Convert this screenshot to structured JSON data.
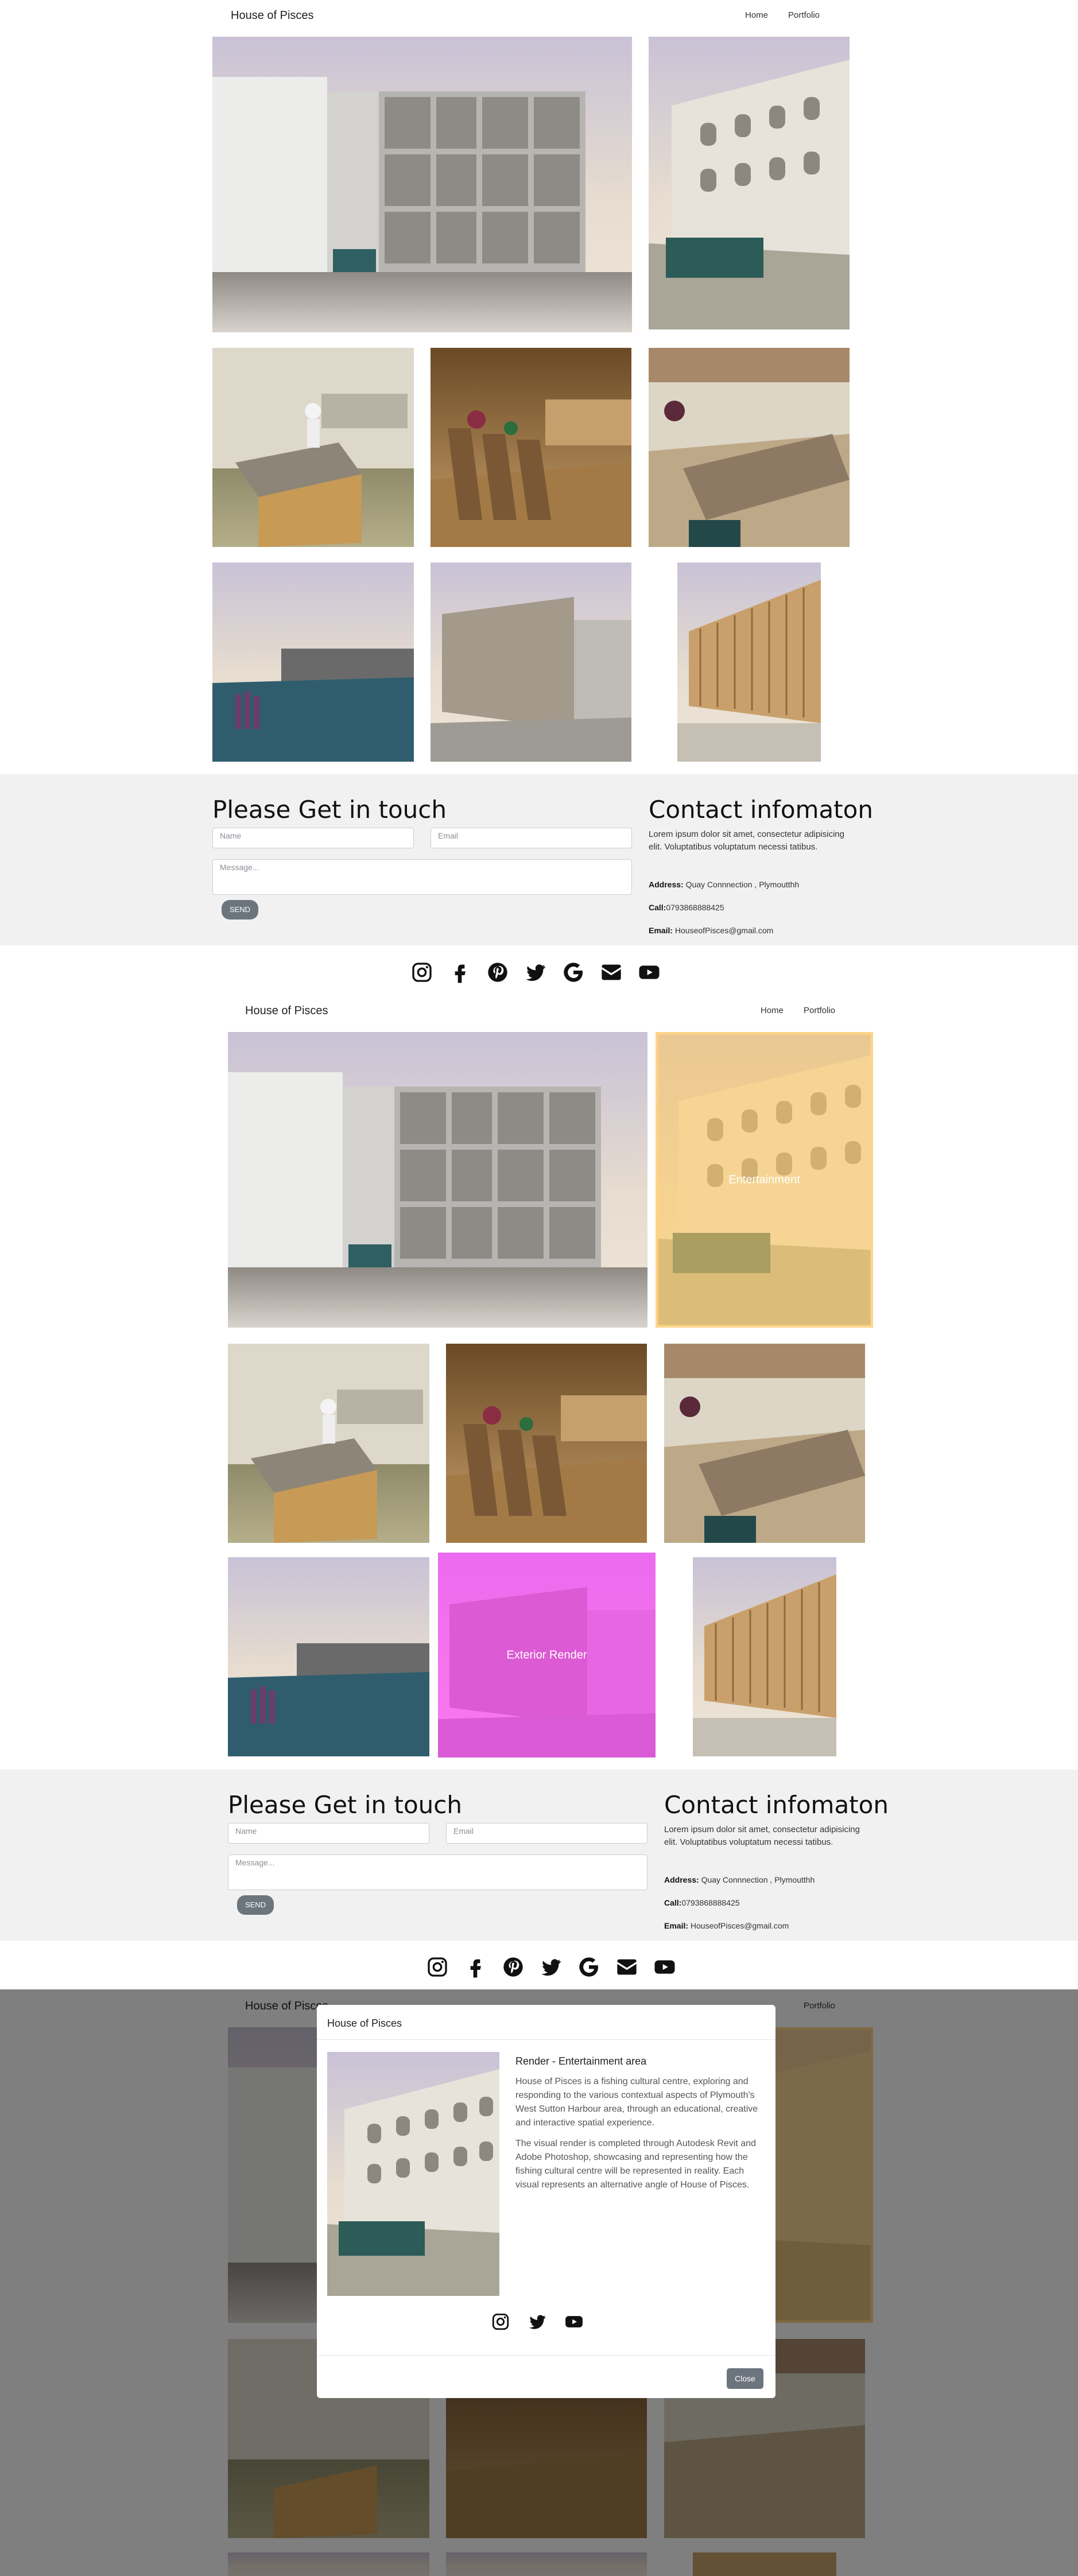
{
  "brand": "House of Pisces",
  "nav": {
    "home": "Home",
    "portfolio": "Portfolio"
  },
  "captions": {
    "entertainment": "Entertainment",
    "exterior": "Exterior Render"
  },
  "contact_form": {
    "title": "Please Get in touch",
    "name_placeholder": "Name",
    "email_placeholder": "Email",
    "message_placeholder": "Message...",
    "send_label": "SEND"
  },
  "contact_info": {
    "title": "Contact infomaton",
    "body": "Lorem ipsum dolor sit amet, consectetur adipisicing elit. Voluptatibus voluptatum necessi tatibus.",
    "address_label": "Address:",
    "address_value": " Quay Connnection , Plymoutthh",
    "call_label": "Call:",
    "call_value": "0793868888425",
    "email_label": "Email:",
    "email_value": " HouseofPisces@gmail.com"
  },
  "social_icons": [
    "instagram-icon",
    "facebook-icon",
    "pinterest-icon",
    "twitter-icon",
    "google-icon",
    "envelope-icon",
    "youtube-icon"
  ],
  "modal": {
    "header": "House of Pisces",
    "heading": "Render - Entertainment area",
    "para1": "House of Pisces is a fishing cultural centre, exploring and responding to the various contextual aspects of Plymouth's West Sutton Harbour area, through an educational, creative and interactive spatial experience.",
    "para2": "The visual render is completed through Autodesk Revit and Adobe Photoshop, showcasing and representing how the fishing cultural centre will be represented in reality. Each visual represents an alternative angle of House of Pisces.",
    "close_label": "Close",
    "social_icons": [
      "instagram-icon",
      "twitter-icon",
      "youtube-icon"
    ]
  },
  "colors": {
    "contact_bg": "#f1f1f1",
    "hover_entertainment": "#ffcc66",
    "hover_exterior": "#ff33ff",
    "overlay": "rgba(0,0,0,0.5)",
    "button_gray": "#6c757d"
  }
}
